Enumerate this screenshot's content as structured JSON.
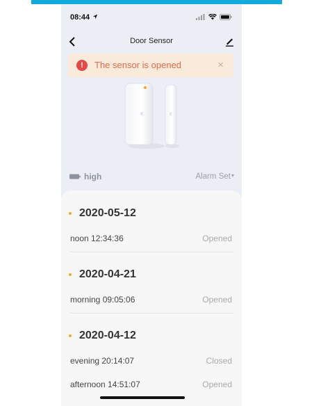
{
  "status_bar": {
    "time": "08:44",
    "icons": [
      "location-arrow-icon",
      "signal-icon",
      "wifi-icon",
      "battery-icon"
    ]
  },
  "nav": {
    "title": "Door Sensor",
    "back_icon": "chevron-left-icon",
    "edit_icon": "edit-pencil-icon"
  },
  "alert": {
    "text": "The sensor is opened",
    "icon": "exclamation-circle-icon",
    "close_glyph": "×"
  },
  "device": {
    "battery_level": "high",
    "alarm_set_label": "Alarm Set",
    "caret_glyph": "▾"
  },
  "history": [
    {
      "date": "2020-05-12",
      "events": [
        {
          "time": "noon  12:34:36",
          "state": "Opened"
        }
      ]
    },
    {
      "date": "2020-04-21",
      "events": [
        {
          "time": "morning  09:05:06",
          "state": "Opened"
        }
      ]
    },
    {
      "date": "2020-04-12",
      "events": [
        {
          "time": "evening  20:14:07",
          "state": "Closed"
        },
        {
          "time": "afternoon  14:51:07",
          "state": "Opened"
        }
      ]
    }
  ],
  "colors": {
    "top_bar": "#14a9dc",
    "alert_bg": "#f9ead9",
    "alert_text": "#e26a4c",
    "alert_icon": "#e44848",
    "date_dot": "#f5a623",
    "screen_bg": "#eceef6",
    "card_bg": "#f7f7f7"
  }
}
